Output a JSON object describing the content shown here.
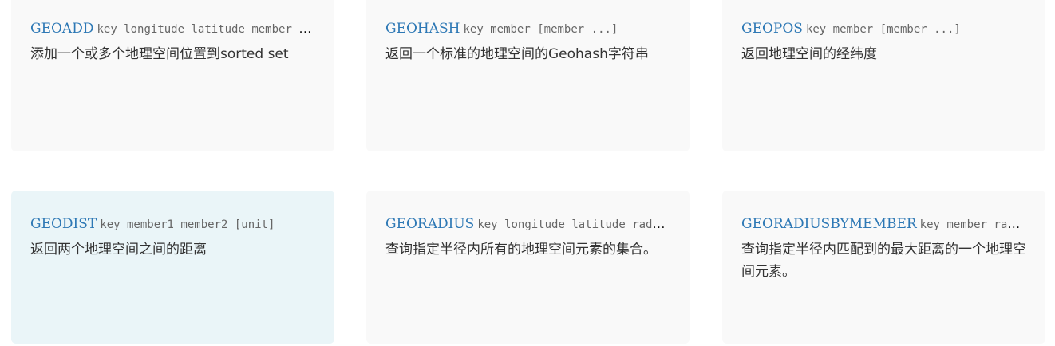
{
  "cards": [
    {
      "command": "GEOADD",
      "args": "key longitude latitude member [longitude latitude member ...]",
      "description": "添加一个或多个地理空间位置到sorted set"
    },
    {
      "command": "GEOHASH",
      "args": "key member [member ...]",
      "description": "返回一个标准的地理空间的Geohash字符串"
    },
    {
      "command": "GEOPOS",
      "args": "key member [member ...]",
      "description": "返回地理空间的经纬度"
    },
    {
      "command": "GEODIST",
      "args": "key member1 member2 [unit]",
      "description": "返回两个地理空间之间的距离"
    },
    {
      "command": "GEORADIUS",
      "args": "key longitude latitude radius m|km|ft|mi [WITHCOORD] [WITHDIST] [WITHHASH] [COUNT count]",
      "description": "查询指定半径内所有的地理空间元素的集合。"
    },
    {
      "command": "GEORADIUSBYMEMBER",
      "args": "key member radius m|km|ft|mi [WITHCOORD] [WITHDIST] [WITHHASH] [COUNT count]",
      "description": "查询指定半径内匹配到的最大距离的一个地理空间元素。"
    }
  ]
}
